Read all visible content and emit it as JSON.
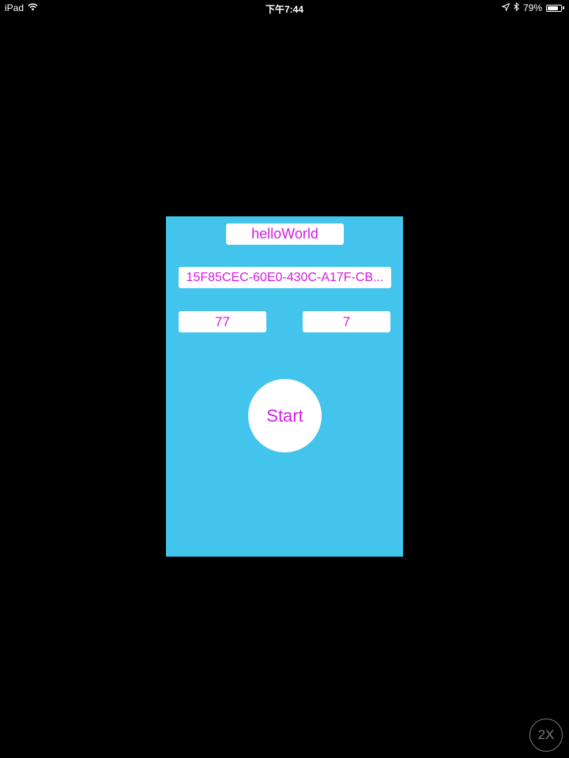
{
  "status_bar": {
    "device": "iPad",
    "time": "下午7:44",
    "battery_percent": "79%",
    "battery_level": 0.79,
    "icons": [
      "wifi-icon",
      "location-icon",
      "bluetooth-icon",
      "battery-icon"
    ]
  },
  "app": {
    "background_color": "#43c4ec",
    "text_color": "#d41ce2",
    "title": "helloWorld",
    "uuid": "15F85CEC-60E0-430C-A17F-CB...",
    "value_left": "77",
    "value_right": "7",
    "start_label": "Start"
  },
  "zoom_button": {
    "label": "2X"
  }
}
